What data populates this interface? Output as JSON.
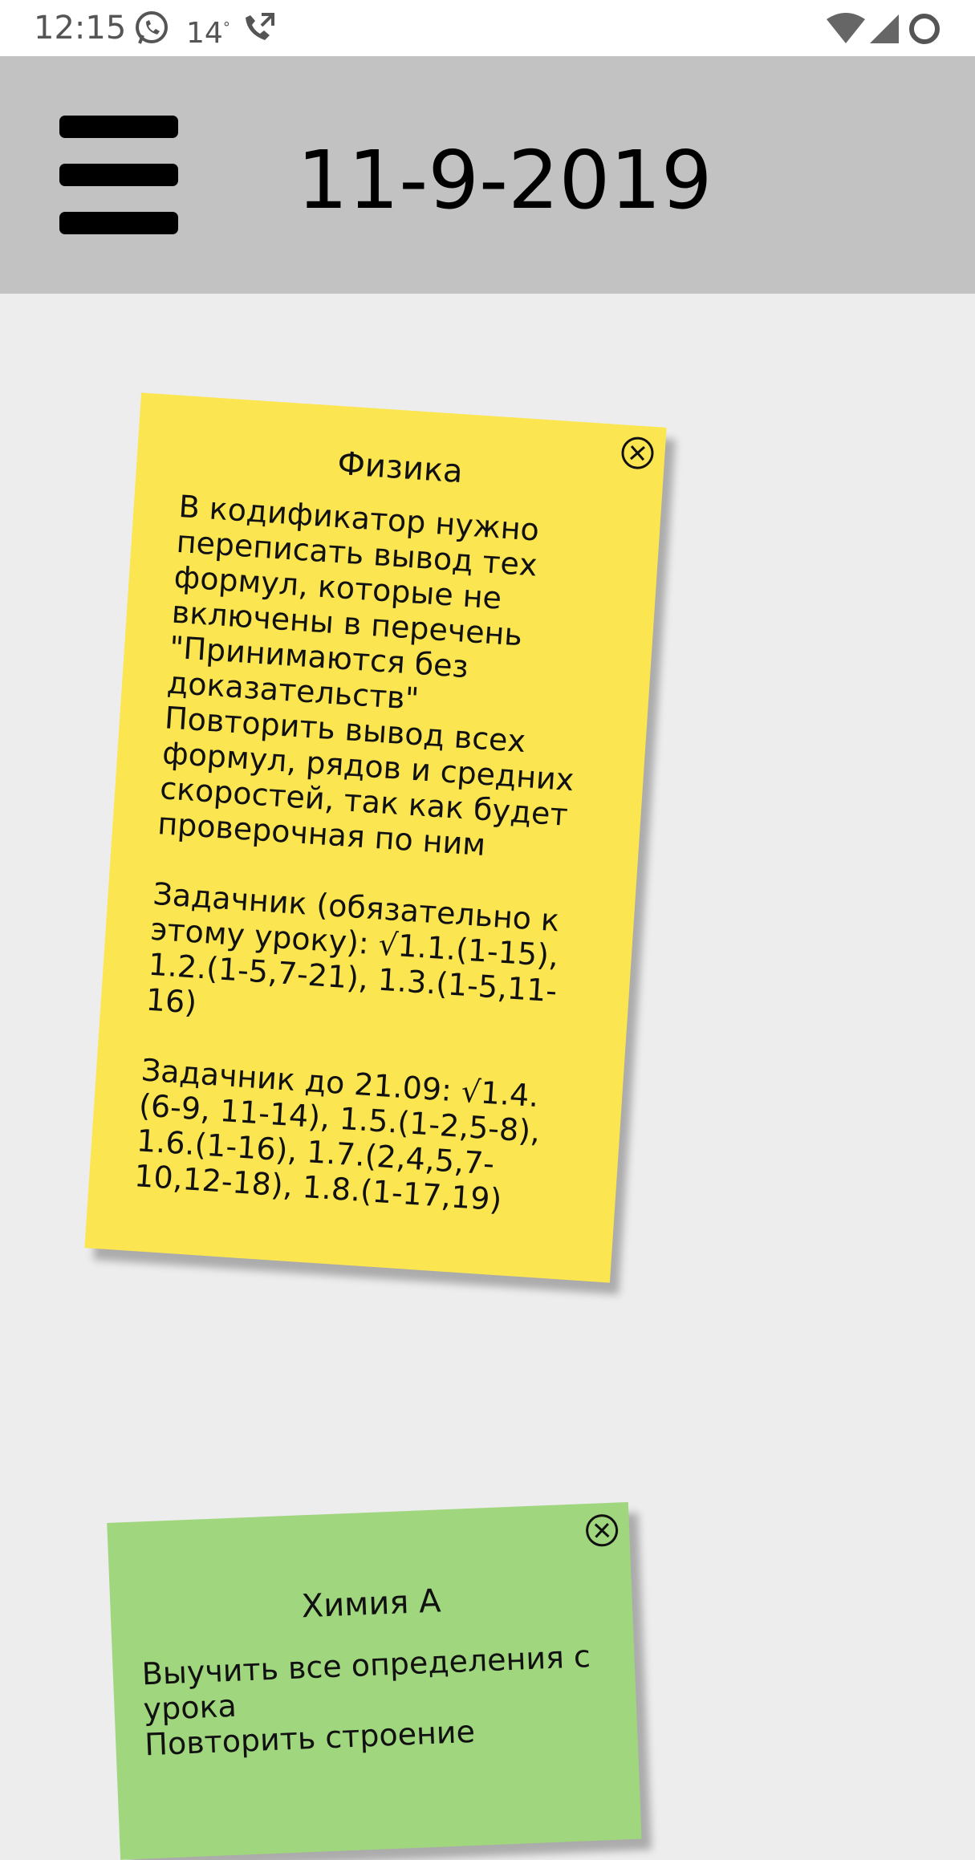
{
  "status_bar": {
    "time": "12:15",
    "temperature": "14",
    "temperature_unit": "°",
    "icons": [
      "whatsapp-icon",
      "missed-call-icon",
      "wifi-icon",
      "signal-icon",
      "battery-icon"
    ]
  },
  "app_bar": {
    "menu_icon": "hamburger-menu-icon",
    "title": "11-9-2019",
    "background": "#c2c2c2"
  },
  "notes": [
    {
      "color": "#fbe652",
      "title": "Физика",
      "body": "В кодификатор нужно переписать вывод тех формул, которые не включены в перечень \"Принимаются без доказательств\"\nПовторить вывод всех формул, рядов и средних скоростей, так как будет проверочная по ним\n\nЗадачник (обязательно к этому уроку): √1.1.(1-15), 1.2.(1-5,7-21), 1.3.(1-5,11-16)\n\nЗадачник до 21.09: √1.4.(6-9, 11-14), 1.5.(1-2,5-8), 1.6.(1-16), 1.7.(2,4,5,7-10,12-18), 1.8.(1-17,19)",
      "close_icon": "close-circle-icon"
    },
    {
      "color": "#a0d77e",
      "title": "Химия А",
      "body": "Выучить все определения с урока\nПовторить строение",
      "close_icon": "close-circle-icon"
    }
  ]
}
